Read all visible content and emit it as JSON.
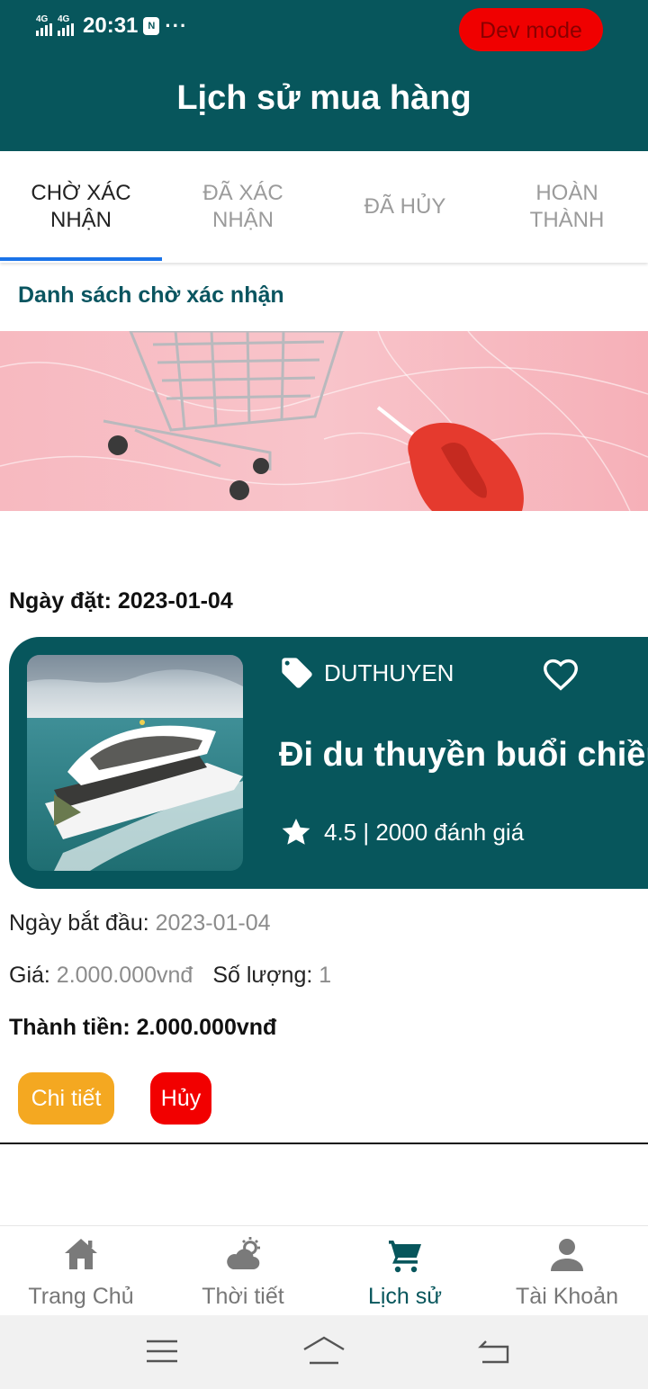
{
  "status_bar": {
    "network_1": "4G",
    "network_2": "4G",
    "time": "20:31",
    "nfc_label": "N",
    "more": "···",
    "dev_badge": "Dev mode"
  },
  "header": {
    "title": "Lịch sử mua hàng"
  },
  "tabs": [
    {
      "label": "CHỜ XÁC\nNHẬN",
      "active": true
    },
    {
      "label": "ĐÃ XÁC\nNHẬN",
      "active": false
    },
    {
      "label": "ĐÃ HỦY",
      "active": false
    },
    {
      "label": "HOÀN\nTHÀNH",
      "active": false
    }
  ],
  "section": {
    "title": "Danh sách chờ xác nhận"
  },
  "order": {
    "date_label": "Ngày đặt: 2023-01-04",
    "card": {
      "category": "DUTHUYEN",
      "title": "Đi du thuyền buổi chiều",
      "rating": "4.5 | 2000 đánh giá"
    },
    "start_label": "Ngày bắt đầu: ",
    "start_value": "2023-01-04",
    "price_label": "Giá: ",
    "price_value": "2.000.000vnđ",
    "qty_label": "Số lượng: ",
    "qty_value": "1",
    "total": "Thành tiền: 2.000.000vnđ",
    "detail_button": "Chi tiết",
    "cancel_button": "Hủy"
  },
  "bottom_nav": [
    {
      "label": "Trang Chủ",
      "icon": "home-icon"
    },
    {
      "label": "Thời tiết",
      "icon": "weather-icon"
    },
    {
      "label": "Lịch sử",
      "icon": "cart-icon",
      "active": true
    },
    {
      "label": "Tài Khoản",
      "icon": "user-icon"
    }
  ],
  "colors": {
    "primary": "#07565c",
    "tab_indicator": "#1a73e8",
    "detail_button": "#f4a821",
    "cancel_button": "#f20000",
    "dev_badge": "#f00000"
  }
}
